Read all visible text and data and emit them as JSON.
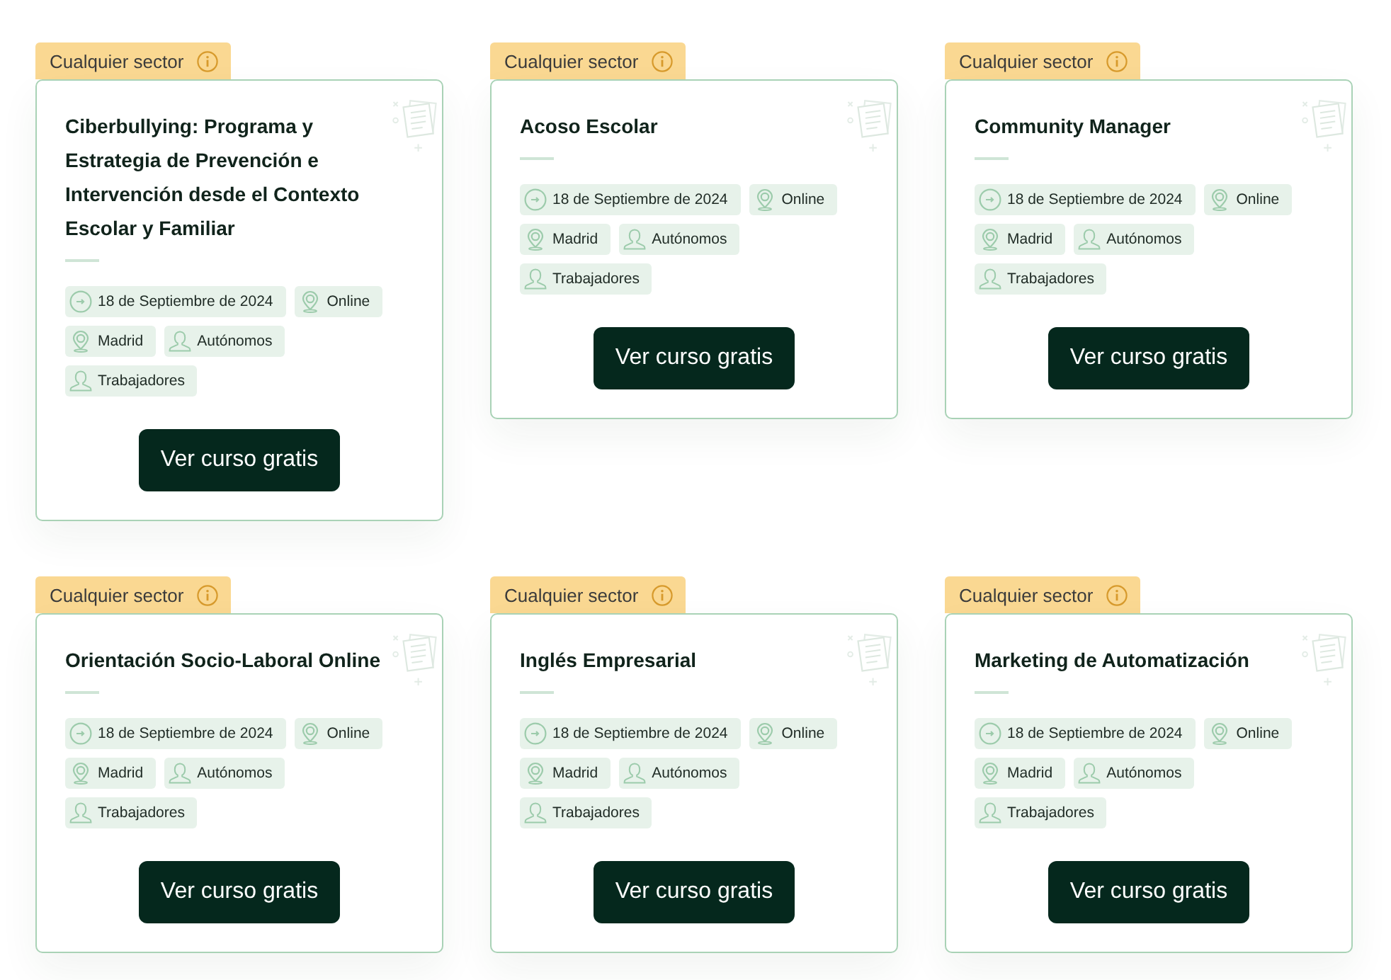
{
  "cards": [
    {
      "sector": "Cualquier sector",
      "title": "Ciberbullying: Programa y Estrategia de Prevención e Intervención desde el Contexto Escolar y Familiar",
      "tags": [
        {
          "kind": "date",
          "label": "18 de Septiembre de 2024"
        },
        {
          "kind": "location",
          "label": "Online"
        },
        {
          "kind": "location",
          "label": "Madrid"
        },
        {
          "kind": "audience",
          "label": "Autónomos"
        },
        {
          "kind": "audience",
          "label": "Trabajadores"
        }
      ],
      "button": "Ver curso gratis"
    },
    {
      "sector": "Cualquier sector",
      "title": "Acoso Escolar",
      "tags": [
        {
          "kind": "date",
          "label": "18 de Septiembre de 2024"
        },
        {
          "kind": "location",
          "label": "Online"
        },
        {
          "kind": "location",
          "label": "Madrid"
        },
        {
          "kind": "audience",
          "label": "Autónomos"
        },
        {
          "kind": "audience",
          "label": "Trabajadores"
        }
      ],
      "button": "Ver curso gratis"
    },
    {
      "sector": "Cualquier sector",
      "title": "Community Manager",
      "tags": [
        {
          "kind": "date",
          "label": "18 de Septiembre de 2024"
        },
        {
          "kind": "location",
          "label": "Online"
        },
        {
          "kind": "location",
          "label": "Madrid"
        },
        {
          "kind": "audience",
          "label": "Autónomos"
        },
        {
          "kind": "audience",
          "label": "Trabajadores"
        }
      ],
      "button": "Ver curso gratis"
    },
    {
      "sector": "Cualquier sector",
      "title": "Orientación Socio-Laboral Online",
      "tags": [
        {
          "kind": "date",
          "label": "18 de Septiembre de 2024"
        },
        {
          "kind": "location",
          "label": "Online"
        },
        {
          "kind": "location",
          "label": "Madrid"
        },
        {
          "kind": "audience",
          "label": "Autónomos"
        },
        {
          "kind": "audience",
          "label": "Trabajadores"
        }
      ],
      "button": "Ver curso gratis"
    },
    {
      "sector": "Cualquier sector",
      "title": "Inglés Empresarial",
      "tags": [
        {
          "kind": "date",
          "label": "18 de Septiembre de 2024"
        },
        {
          "kind": "location",
          "label": "Online"
        },
        {
          "kind": "location",
          "label": "Madrid"
        },
        {
          "kind": "audience",
          "label": "Autónomos"
        },
        {
          "kind": "audience",
          "label": "Trabajadores"
        }
      ],
      "button": "Ver curso gratis"
    },
    {
      "sector": "Cualquier sector",
      "title": "Marketing de Automatización",
      "tags": [
        {
          "kind": "date",
          "label": "18 de Septiembre de 2024"
        },
        {
          "kind": "location",
          "label": "Online"
        },
        {
          "kind": "location",
          "label": "Madrid"
        },
        {
          "kind": "audience",
          "label": "Autónomos"
        },
        {
          "kind": "audience",
          "label": "Trabajadores"
        }
      ],
      "button": "Ver curso gratis"
    }
  ]
}
